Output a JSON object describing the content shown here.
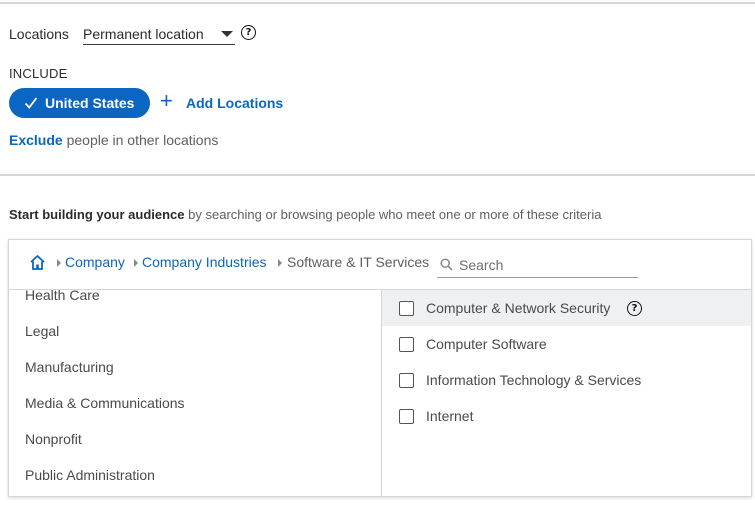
{
  "locations": {
    "label": "Locations",
    "selected": "Permanent location",
    "help_icon": "question-circle-icon",
    "include_label": "INCLUDE",
    "included": [
      {
        "label": "United States",
        "icon": "checkmark-icon"
      }
    ],
    "add_label": "Add Locations",
    "exclude_link": "Exclude",
    "exclude_rest": " people in other locations"
  },
  "audience": {
    "lead_bold": "Start building your audience",
    "lead_rest": " by searching or browsing people who meet one or more of these criteria"
  },
  "browser": {
    "breadcrumb": [
      {
        "label": "Company",
        "link": true
      },
      {
        "label": "Company Industries",
        "link": true
      },
      {
        "label": "Software & IT Services",
        "link": false
      }
    ],
    "search_placeholder": "Search",
    "categories": [
      "Health Care",
      "Legal",
      "Manufacturing",
      "Media & Communications",
      "Nonprofit",
      "Public Administration"
    ],
    "options": [
      {
        "label": "Computer & Network Security",
        "checked": false,
        "highlighted": true,
        "help": true
      },
      {
        "label": "Computer Software",
        "checked": false
      },
      {
        "label": "Information Technology & Services",
        "checked": false
      },
      {
        "label": "Internet",
        "checked": false
      }
    ]
  },
  "colors": {
    "accent": "#0a66c2",
    "divider": "#cfd8dd",
    "highlight_row": "#eef0f2"
  }
}
